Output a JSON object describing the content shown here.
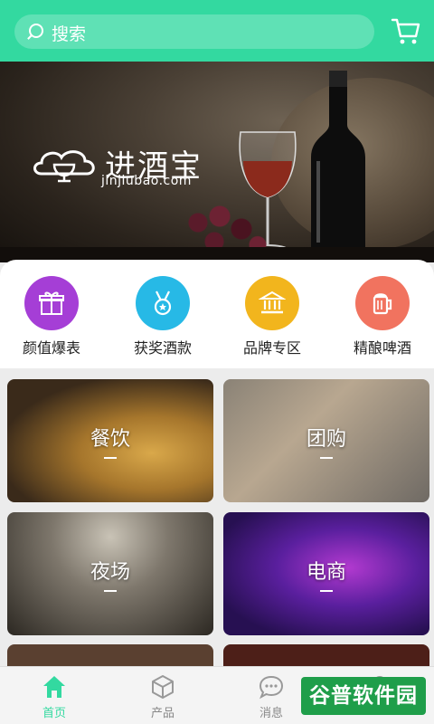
{
  "header": {
    "search_placeholder": "搜索",
    "icons": {
      "search": "search-icon",
      "cart": "cart-icon"
    }
  },
  "banner": {
    "brand_name": "进酒宝",
    "brand_domain": "jinjiubao.com"
  },
  "categories": [
    {
      "label": "颜值爆表",
      "icon": "gift-icon",
      "color": "#a53ed6"
    },
    {
      "label": "获奖酒款",
      "icon": "medal-icon",
      "color": "#27b9e6"
    },
    {
      "label": "品牌专区",
      "icon": "bank-icon",
      "color": "#f2b51d"
    },
    {
      "label": "精酿啤酒",
      "icon": "beer-icon",
      "color": "#f1735f"
    }
  ],
  "tiles": [
    {
      "label": "餐饮"
    },
    {
      "label": "团购"
    },
    {
      "label": "夜场"
    },
    {
      "label": "电商"
    }
  ],
  "tabbar": {
    "items": [
      {
        "label": "首页",
        "icon": "home-icon",
        "active": true
      },
      {
        "label": "产品",
        "icon": "box-icon"
      },
      {
        "label": "消息",
        "icon": "chat-icon"
      },
      {
        "label": "",
        "icon": "user-icon"
      }
    ]
  },
  "watermark": {
    "text": "谷普软件园"
  },
  "colors": {
    "accent": "#33d9a0",
    "tab_inactive": "#888888"
  }
}
